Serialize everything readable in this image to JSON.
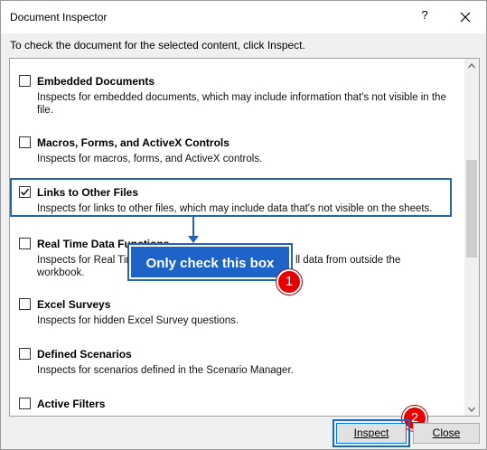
{
  "dialog": {
    "title": "Document Inspector",
    "help_label": "?",
    "instruction": "To check the document for the selected content, click Inspect."
  },
  "items": [
    {
      "title": "Embedded Documents",
      "desc": "Inspects for embedded documents, which may include information that's not visible in the file.",
      "checked": false
    },
    {
      "title": "Macros, Forms, and ActiveX Controls",
      "desc": "Inspects for macros, forms, and ActiveX controls.",
      "checked": false
    },
    {
      "title": "Links to Other Files",
      "desc": "Inspects for links to other files, which may include data that's not visible on the sheets.",
      "checked": true
    },
    {
      "title": "Real Time Data Functions",
      "desc_left": "Inspects for Real Tim",
      "desc_right": "ll data from outside the",
      "desc_line2": "workbook.",
      "checked": false
    },
    {
      "title": "Excel Surveys",
      "desc": "Inspects for hidden Excel Survey questions.",
      "checked": false
    },
    {
      "title": "Defined Scenarios",
      "desc": "Inspects for scenarios defined in the Scenario Manager.",
      "checked": false
    },
    {
      "title": "Active Filters",
      "checked": false
    }
  ],
  "callout": {
    "text": "Only check this box"
  },
  "badges": {
    "one": "1",
    "two": "2"
  },
  "buttons": {
    "inspect": "Inspect",
    "close": "Close"
  },
  "colors": {
    "accent": "#1f65b5",
    "callout_bg": "#1e64c8",
    "badge": "#e60000"
  }
}
